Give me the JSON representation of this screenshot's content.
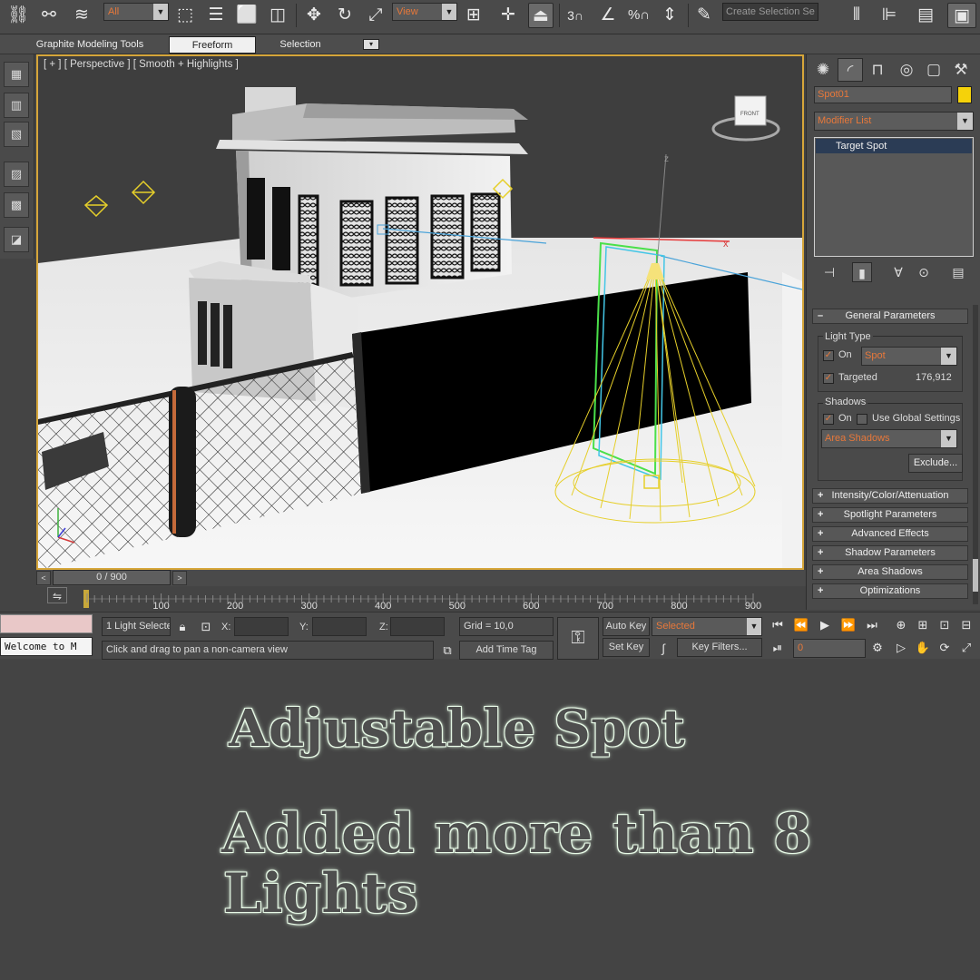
{
  "toolbar": {
    "selection_filter": "All",
    "ref_coord": "View",
    "snap_label": "3",
    "named_selection_placeholder": "Create Selection Se"
  },
  "ribbon": {
    "tabs": [
      {
        "label": "Graphite Modeling Tools",
        "active": false
      },
      {
        "label": "Freeform",
        "active": true
      },
      {
        "label": "Selection",
        "active": false
      }
    ]
  },
  "viewport": {
    "label": "[ + ] [ Perspective ] [ Smooth + Highlights ]",
    "viewcube_face": "FRONT",
    "border_color": "#d6a63a"
  },
  "command_panel": {
    "object_name": "Spot01",
    "object_color": "#f5d20a",
    "modifier_list": "Modifier List",
    "stack_item": "Target Spot",
    "general_parameters": {
      "title": "General Parameters",
      "light_type_label": "Light Type",
      "on_label": "On",
      "light_type_value": "Spot",
      "targeted_label": "Targeted",
      "target_distance": "176,912",
      "shadows_label": "Shadows",
      "shadows_on_label": "On",
      "use_global_label": "Use Global Settings",
      "shadow_type": "Area Shadows",
      "exclude_button": "Exclude..."
    },
    "rollouts": [
      "Intensity/Color/Attenuation",
      "Spotlight Parameters",
      "Advanced Effects",
      "Shadow Parameters",
      "Area Shadows",
      "Optimizations"
    ]
  },
  "time_slider": {
    "value": "0 / 900",
    "ticks": [
      "100",
      "200",
      "300",
      "400",
      "500",
      "600",
      "700",
      "800",
      "900"
    ]
  },
  "status_bar": {
    "maxscript_pink": "",
    "maxscript_white": "Welcome to M",
    "selection_count": "1 Light Selecte",
    "x_label": "X:",
    "y_label": "Y:",
    "z_label": "Z:",
    "grid": "Grid = 10,0",
    "prompt": "Click and drag to pan a non-camera view",
    "add_time_tag": "Add Time Tag",
    "auto_key": "Auto Key",
    "set_key": "Set Key",
    "key_mode": "Selected",
    "key_filters": "Key Filters...",
    "frame": "0"
  },
  "captions": {
    "line1": "Adjustable Spot",
    "line2": "Added more than 8",
    "line3": "Lights"
  }
}
